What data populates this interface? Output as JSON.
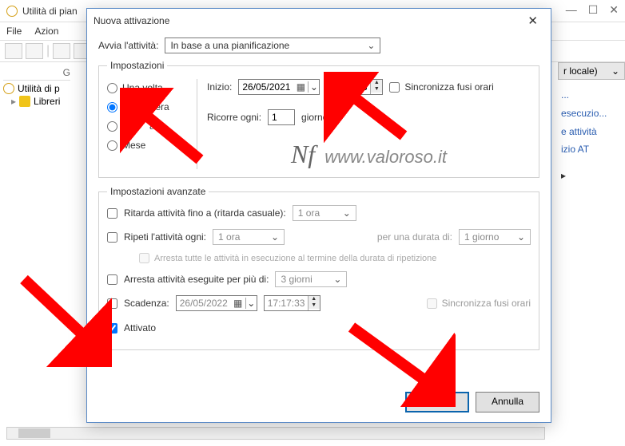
{
  "bg": {
    "title": "Utilità di pian",
    "menu": [
      "File",
      "Azion"
    ],
    "tree_root": "Utilità di p",
    "tree_child": "Libreri",
    "col_g": "G"
  },
  "right": {
    "header": "r locale)",
    "items": [
      "...",
      "",
      "esecuzio...",
      "e attività",
      "izio AT"
    ],
    "arrow": "▸"
  },
  "dialog": {
    "title": "Nuova attivazione",
    "start_label": "Avvia l'attività:",
    "start_value": "In base a una pianificazione",
    "settings_legend": "Impostazioni",
    "radios": {
      "once": "Una volta",
      "daily": "Giornaliera",
      "weekly_partial": "ana",
      "monthly": "Mese"
    },
    "start": "Inizio:",
    "start_date": "26/05/2021",
    "start_time": "22:30:00",
    "sync_tz": "Sincronizza fusi orari",
    "recur": "Ricorre ogni:",
    "recur_val": "1",
    "recur_unit": "giorno/i",
    "watermark": "www.valoroso.it",
    "adv_legend": "Impostazioni avanzate",
    "delay": "Ritarda attività fino a (ritarda casuale):",
    "delay_val": "1 ora",
    "repeat": "Ripeti l'attività ogni:",
    "repeat_val": "1 ora",
    "duration_lbl": "per una durata di:",
    "duration_val": "1 giorno",
    "stop_all": "Arresta tutte le attività in esecuzione al termine della durata di ripetizione",
    "stop_after": "Arresta attività eseguite per più di:",
    "stop_after_val": "3 giorni",
    "expire": "Scadenza:",
    "expire_date": "26/05/2022",
    "expire_time": "17:17:33",
    "expire_sync": "Sincronizza fusi orari",
    "enabled": "Attivato",
    "ok": "OK",
    "cancel": "Annulla"
  }
}
